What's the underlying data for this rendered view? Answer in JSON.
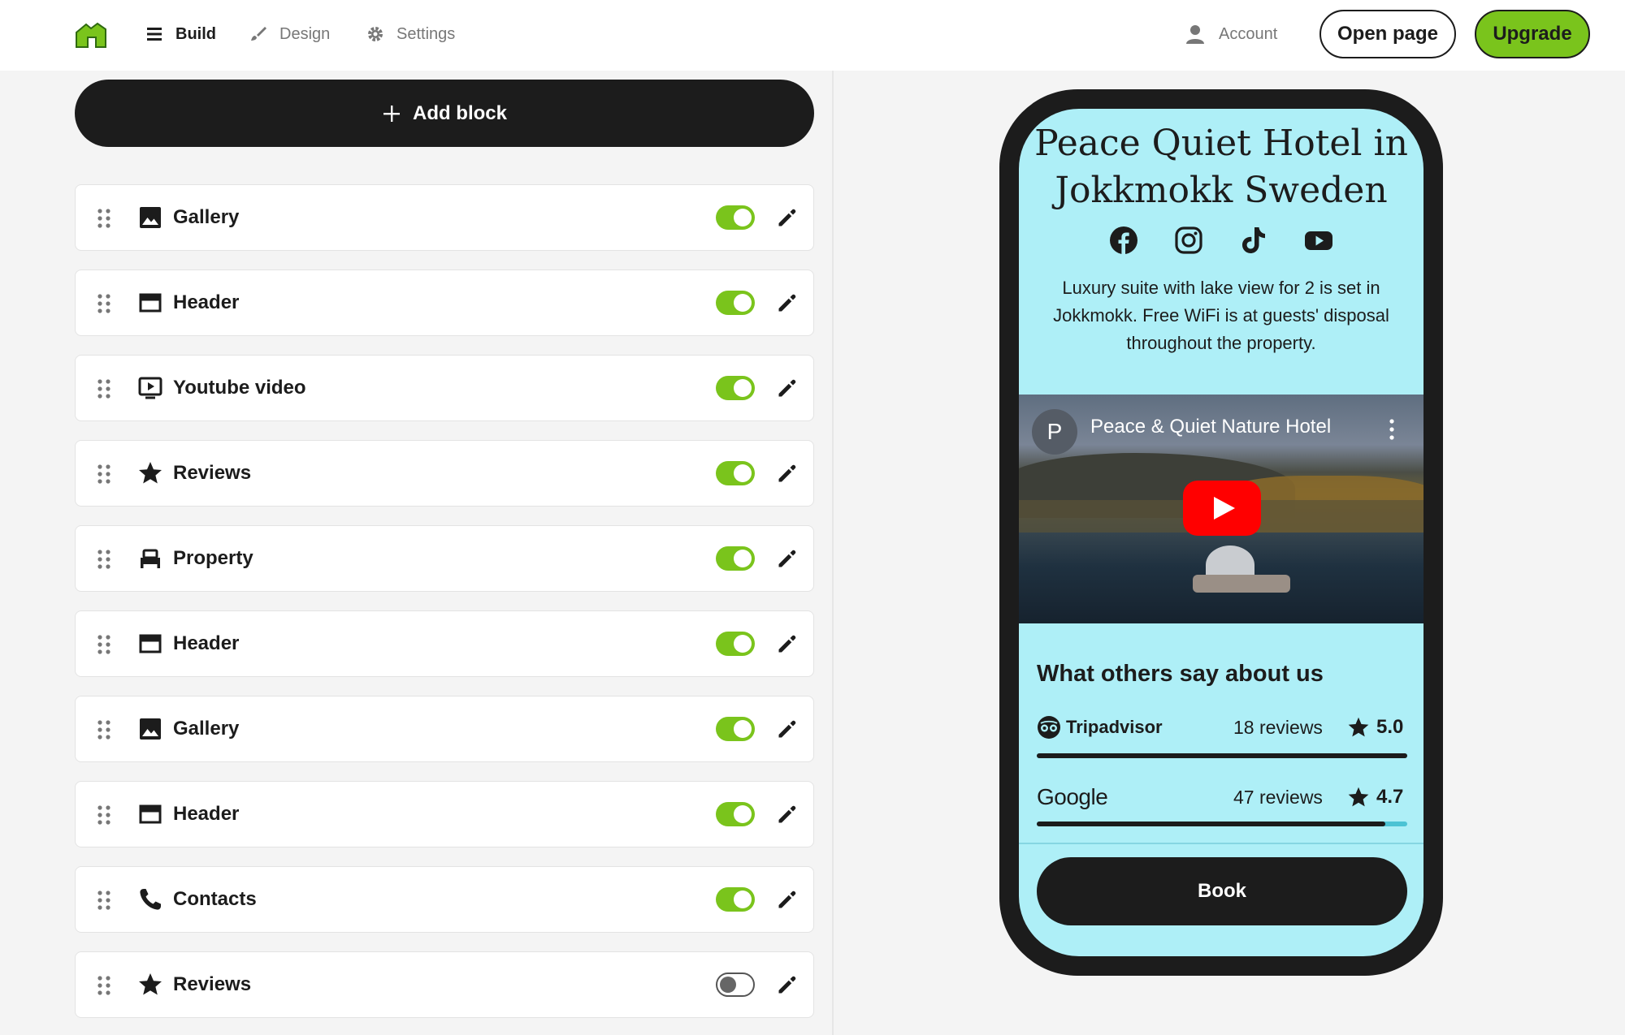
{
  "nav": {
    "build": "Build",
    "design": "Design",
    "settings": "Settings",
    "account": "Account",
    "open_page": "Open page",
    "upgrade": "Upgrade"
  },
  "colors": {
    "accent": "#7ac41c",
    "dark": "#1c1c1c",
    "preview_bg": "#aeeff7"
  },
  "editor": {
    "add_block": "Add block",
    "blocks": [
      {
        "label": "Gallery",
        "icon": "image-icon",
        "enabled": true
      },
      {
        "label": "Header",
        "icon": "header-icon",
        "enabled": true
      },
      {
        "label": "Youtube video",
        "icon": "video-icon",
        "enabled": true
      },
      {
        "label": "Reviews",
        "icon": "star-icon",
        "enabled": true
      },
      {
        "label": "Property",
        "icon": "bed-icon",
        "enabled": true
      },
      {
        "label": "Header",
        "icon": "header-icon",
        "enabled": true
      },
      {
        "label": "Gallery",
        "icon": "image-icon",
        "enabled": true
      },
      {
        "label": "Header",
        "icon": "header-icon",
        "enabled": true
      },
      {
        "label": "Contacts",
        "icon": "phone-icon",
        "enabled": true
      },
      {
        "label": "Reviews",
        "icon": "star-icon",
        "enabled": false
      }
    ]
  },
  "preview": {
    "title": "Peace Quiet Hotel in Jokkmokk Sweden",
    "socials": [
      "facebook-icon",
      "instagram-icon",
      "tiktok-icon",
      "youtube-icon"
    ],
    "description": "Luxury suite with lake view for 2 is set in Jokkmokk. Free WiFi is at guests' disposal throughout the property.",
    "video": {
      "channel_initial": "P",
      "title": "Peace & Quiet Nature Hotel"
    },
    "reviews": {
      "title": "What others say about us",
      "items": [
        {
          "brand": "Tripadvisor",
          "count": "18 reviews",
          "score": "5.0",
          "fill_fraction": 1.0
        },
        {
          "brand": "Google",
          "count": "47 reviews",
          "score": "4.7",
          "fill_fraction": 0.94
        }
      ]
    },
    "book": "Book"
  }
}
